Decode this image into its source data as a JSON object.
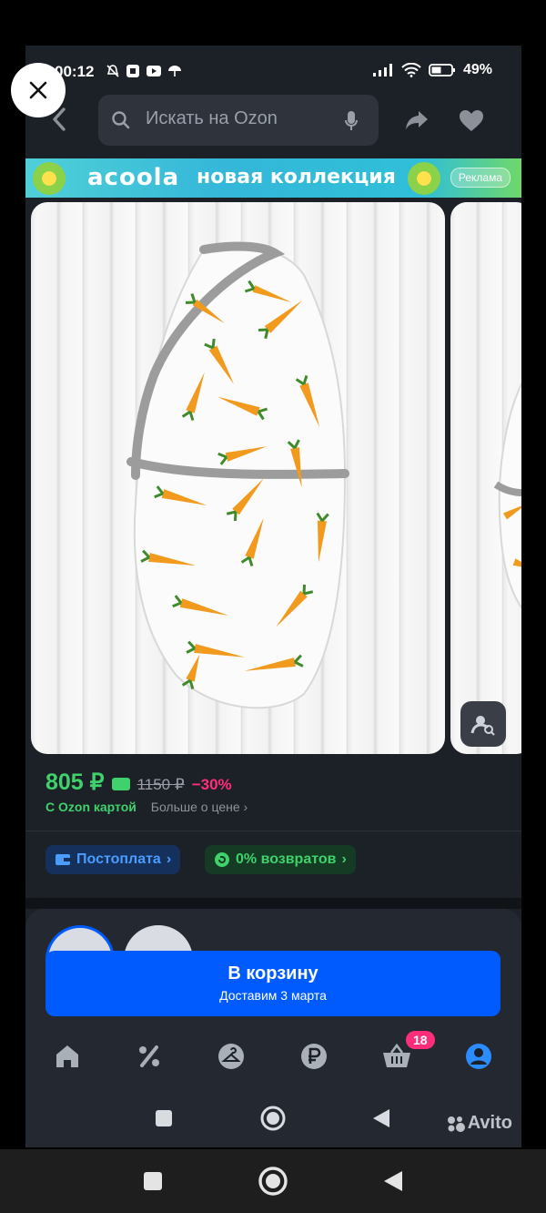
{
  "status": {
    "time": "00:12",
    "battery": "49%"
  },
  "search": {
    "placeholder": "Искать на Ozon"
  },
  "ad": {
    "brand": "acoola",
    "tagline": "новая коллекция",
    "label": "Реклама"
  },
  "product": {
    "price": "805 ₽",
    "old_price": "1150 ₽",
    "discount": "−30%",
    "card_text": "С Ozon картой",
    "more_price": "Больше о цене",
    "chips": [
      "Постоплата",
      "0% возвратов"
    ]
  },
  "cart": {
    "button_label": "В корзину",
    "delivery": "Доставим 3 марта"
  },
  "tabbar": {
    "cart_badge": "18",
    "items": [
      "home-icon",
      "percent-icon",
      "hanger-icon",
      "ruble-icon",
      "basket-icon",
      "profile-icon"
    ]
  },
  "watermark": "Avito",
  "colors": {
    "accent": "#005bff",
    "price_green": "#3fd16b",
    "discount_pink": "#ff2e7a",
    "background": "#1c2027"
  }
}
